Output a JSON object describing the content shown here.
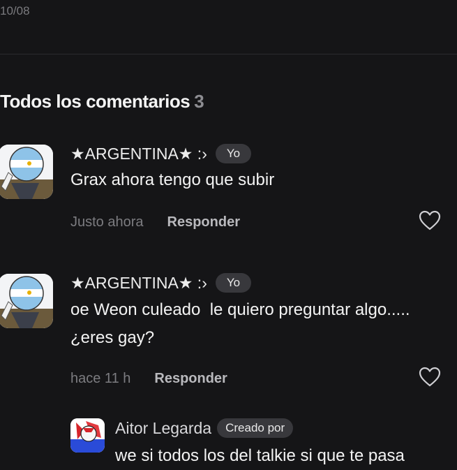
{
  "header": {
    "date": "10/08"
  },
  "section": {
    "title": "Todos los comentarios",
    "count": "3"
  },
  "comments": [
    {
      "author": "★ARGENTINA★ :›",
      "badge": "Yo",
      "text": "Grax ahora tengo que subir",
      "time": "Justo ahora",
      "reply_label": "Responder",
      "avatar_icon": "countryhuman-argentina-avatar"
    },
    {
      "author": "★ARGENTINA★ :›",
      "badge": "Yo",
      "text_lines": [
        "oe Weon culeado  le quiero preguntar algo.....",
        "¿eres gay?"
      ],
      "time": "hace 11 h",
      "reply_label": "Responder",
      "avatar_icon": "countryhuman-argentina-avatar"
    }
  ],
  "reply": {
    "author": "Aitor Legarda",
    "badge": "Creado por",
    "text": "we si todos los del talkie si que te pasa",
    "avatar_icon": "red-character-avatar"
  },
  "colors": {
    "background": "#151517",
    "badge_bg": "#38383c",
    "muted": "#7c7c80"
  }
}
